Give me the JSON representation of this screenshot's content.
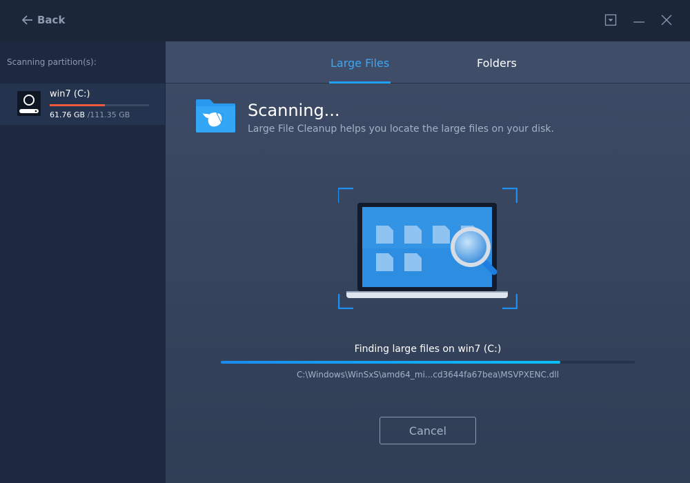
{
  "titlebar": {
    "back_label": "Back"
  },
  "sidebar": {
    "label": "Scanning partition(s):",
    "partitions": [
      {
        "name": "win7 (C:)",
        "used": "61.76 GB",
        "total": "/111.35 GB",
        "used_fraction": 0.555
      }
    ]
  },
  "tabs": [
    {
      "label": "Large Files",
      "active": true
    },
    {
      "label": "Folders",
      "active": false
    }
  ],
  "main": {
    "title": "Scanning...",
    "subtitle": "Large File Cleanup helps you locate the large files on your disk.",
    "status": "Finding large files on win7 (C:)",
    "progress_percent": 82,
    "current_path": "C:\\Windows\\WinSxS\\amd64_mi...cd3644fa67bea\\MSVPXENC.dll",
    "cancel_label": "Cancel"
  },
  "colors": {
    "accent": "#1ea0f5",
    "disk_used": "#f05a3a"
  }
}
